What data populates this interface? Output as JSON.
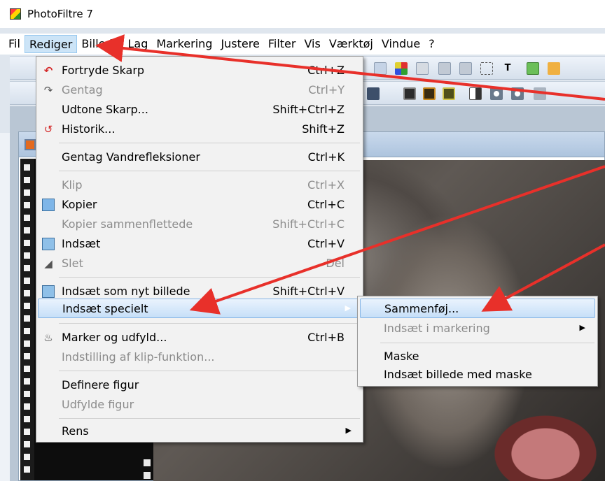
{
  "window": {
    "title": "PhotoFiltre 7"
  },
  "menubar": {
    "items": [
      {
        "label": "Fil"
      },
      {
        "label": "Rediger",
        "active": true
      },
      {
        "label": "Billede"
      },
      {
        "label": "Lag"
      },
      {
        "label": "Markering"
      },
      {
        "label": "Justere"
      },
      {
        "label": "Filter"
      },
      {
        "label": "Vis"
      },
      {
        "label": "Værktøj"
      },
      {
        "label": "Vindue"
      },
      {
        "label": "?"
      }
    ]
  },
  "edit_menu": {
    "items": [
      {
        "icon": "undo-icon",
        "label": "Fortryde Skarp",
        "shortcut": "Ctrl+Z",
        "enabled": true
      },
      {
        "icon": "redo-icon",
        "label": "Gentag",
        "shortcut": "Ctrl+Y",
        "enabled": false
      },
      {
        "icon": "",
        "label": "Udtone Skarp...",
        "shortcut": "Shift+Ctrl+Z",
        "enabled": true
      },
      {
        "icon": "history-icon",
        "label": "Historik...",
        "shortcut": "Shift+Z",
        "enabled": true
      },
      {
        "icon": "",
        "label": "Gentag Vandrefleksioner",
        "shortcut": "Ctrl+K",
        "enabled": true
      },
      {
        "icon": "",
        "label": "Klip",
        "shortcut": "Ctrl+X",
        "enabled": false
      },
      {
        "icon": "copy-icon",
        "label": "Kopier",
        "shortcut": "Ctrl+C",
        "enabled": true
      },
      {
        "icon": "",
        "label": "Kopier sammenflettede",
        "shortcut": "Shift+Ctrl+C",
        "enabled": false
      },
      {
        "icon": "paste-icon",
        "label": "Indsæt",
        "shortcut": "Ctrl+V",
        "enabled": true
      },
      {
        "icon": "eraser-icon",
        "label": "Slet",
        "shortcut": "Del",
        "enabled": false
      },
      {
        "icon": "paste-new-icon",
        "label": "Indsæt som nyt billede",
        "shortcut": "Shift+Ctrl+V",
        "enabled": true
      },
      {
        "icon": "",
        "label": "Indsæt specielt",
        "shortcut": "",
        "enabled": true,
        "submenu": true,
        "selected": true
      },
      {
        "icon": "fill-icon",
        "label": "Marker og udfyld...",
        "shortcut": "Ctrl+B",
        "enabled": true
      },
      {
        "icon": "",
        "label": "Indstilling af klip-funktion...",
        "shortcut": "",
        "enabled": false
      },
      {
        "icon": "",
        "label": "Definere figur",
        "shortcut": "",
        "enabled": true
      },
      {
        "icon": "",
        "label": "Udfylde figur",
        "shortcut": "",
        "enabled": false
      },
      {
        "icon": "",
        "label": "Rens",
        "shortcut": "",
        "enabled": true,
        "submenu": true
      }
    ]
  },
  "paste_special_submenu": {
    "items": [
      {
        "label": "Sammenføj...",
        "enabled": true,
        "selected": true
      },
      {
        "label": "Indsæt i markering",
        "enabled": false,
        "submenu": true
      },
      {
        "label": "Maske",
        "enabled": true
      },
      {
        "label": "Indsæt billede med maske",
        "enabled": true
      }
    ]
  },
  "colors": {
    "selection": "#c6dff8",
    "annotation_arrow": "#e8302a",
    "menubar_active": "#cce4f7"
  }
}
